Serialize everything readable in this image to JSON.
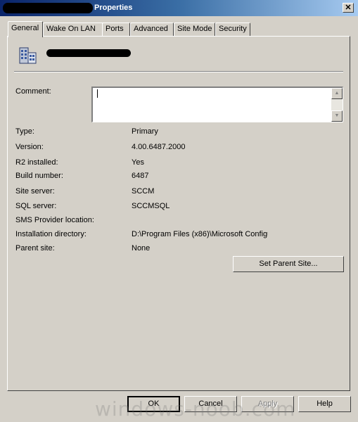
{
  "window": {
    "title": "Properties",
    "close_glyph": "✕"
  },
  "tabs": [
    {
      "label": "General",
      "active": true
    },
    {
      "label": "Wake On LAN"
    },
    {
      "label": "Ports"
    },
    {
      "label": "Advanced"
    },
    {
      "label": "Site Mode"
    },
    {
      "label": "Security"
    }
  ],
  "general": {
    "icon": "site-server-icon",
    "comment_label": "Comment:",
    "comment_value": "",
    "scroll_up": "▲",
    "scroll_down": "▼",
    "fields": [
      {
        "label": "Type:",
        "value": "Primary"
      },
      {
        "label": "Version:",
        "value": "4.00.6487.2000"
      },
      {
        "label": "R2 installed:",
        "value": "Yes"
      },
      {
        "label": "Build number:",
        "value": "6487"
      },
      {
        "label": "Site server:",
        "value": "SCCM"
      },
      {
        "label": "SQL server:",
        "value": "SCCMSQL"
      },
      {
        "label": "SMS Provider location:",
        "value": ""
      },
      {
        "label": "Installation directory:",
        "value": "D:\\Program Files (x86)\\Microsoft Configu"
      },
      {
        "label": "Parent site:",
        "value": "None"
      }
    ],
    "set_parent_button": "Set Parent Site..."
  },
  "footer": {
    "ok": "OK",
    "cancel": "Cancel",
    "apply": "Apply",
    "help": "Help"
  },
  "watermark": "windows-noob.com"
}
